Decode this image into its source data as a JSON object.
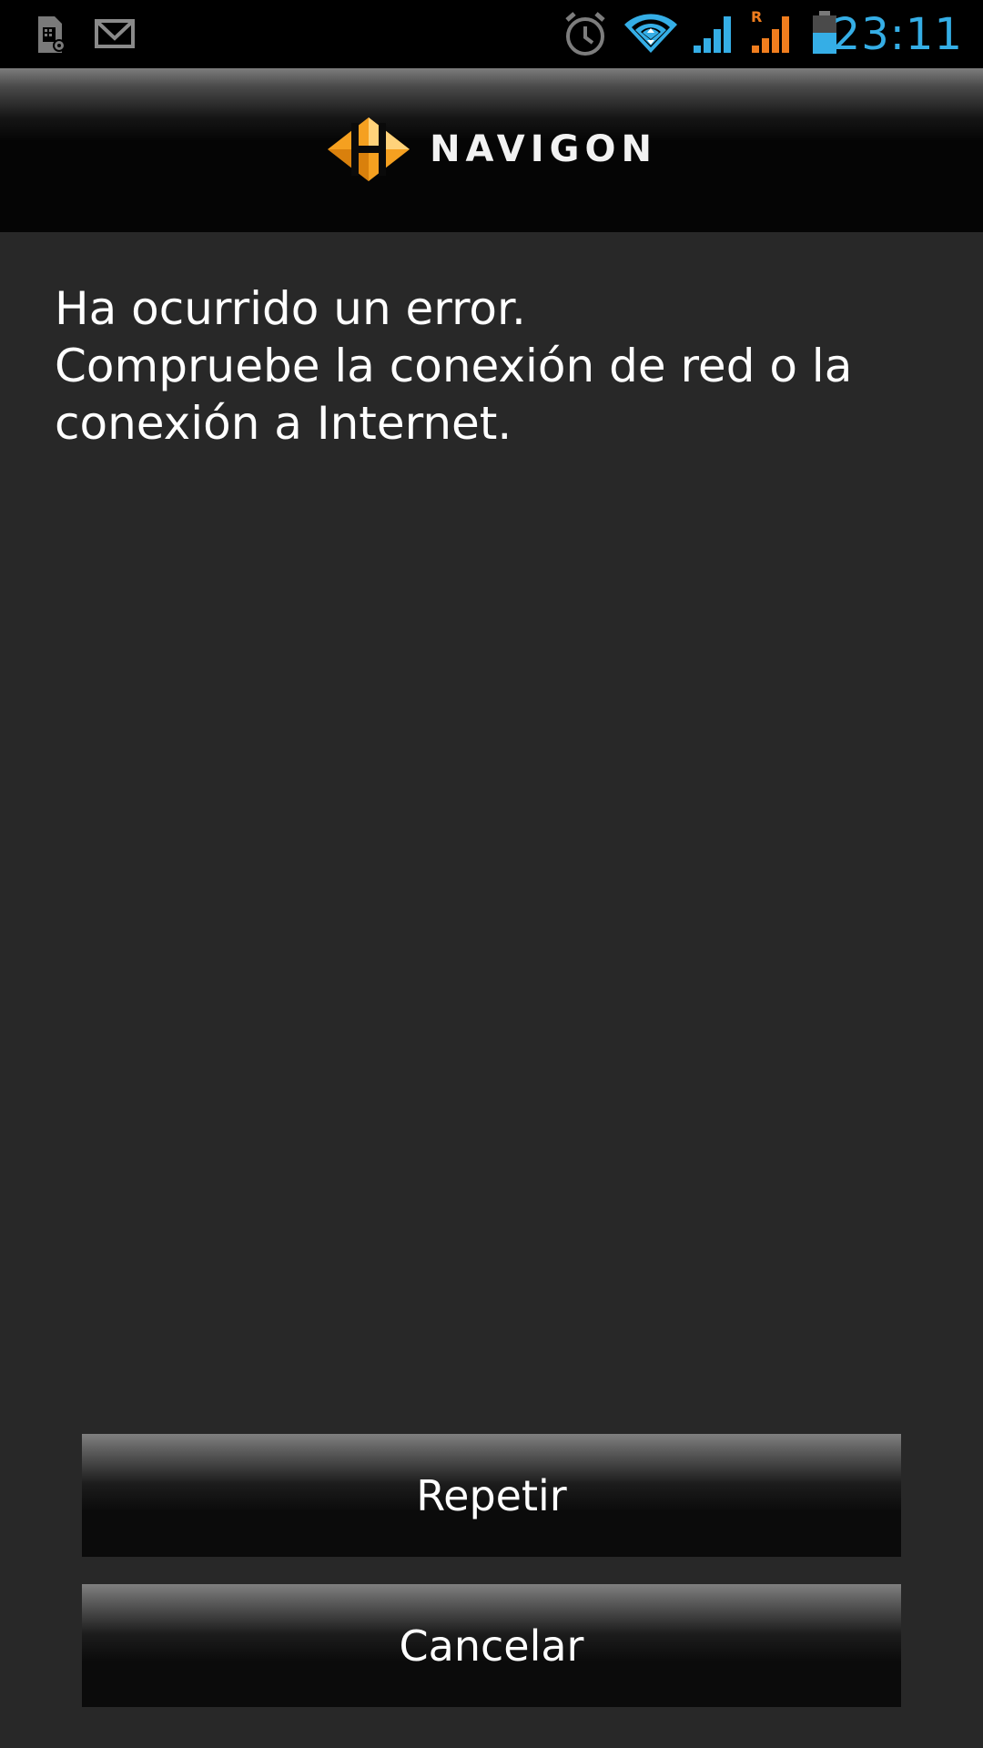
{
  "status_bar": {
    "time": "23:11",
    "icons": [
      "sim-settings-icon",
      "gmail-icon",
      "alarm-icon",
      "wifi-icon",
      "signal-icon",
      "roaming-signal-icon",
      "battery-icon"
    ],
    "roaming_indicator": "R",
    "colors": {
      "time": "#35aee6",
      "wifi": "#35aee6",
      "signal": "#35aee6",
      "roaming_signal": "#f07d1e",
      "battery": "#35aee6"
    }
  },
  "header": {
    "brand_name": "NAVIGON",
    "logo_icon": "navigon-logo-icon",
    "logo_color": "#f5a020"
  },
  "message": {
    "lines": [
      "Ha ocurrido un error.",
      "Compruebe la conexión de red o la",
      "conexión a Internet."
    ]
  },
  "buttons": {
    "retry_label": "Repetir",
    "cancel_label": "Cancelar"
  }
}
